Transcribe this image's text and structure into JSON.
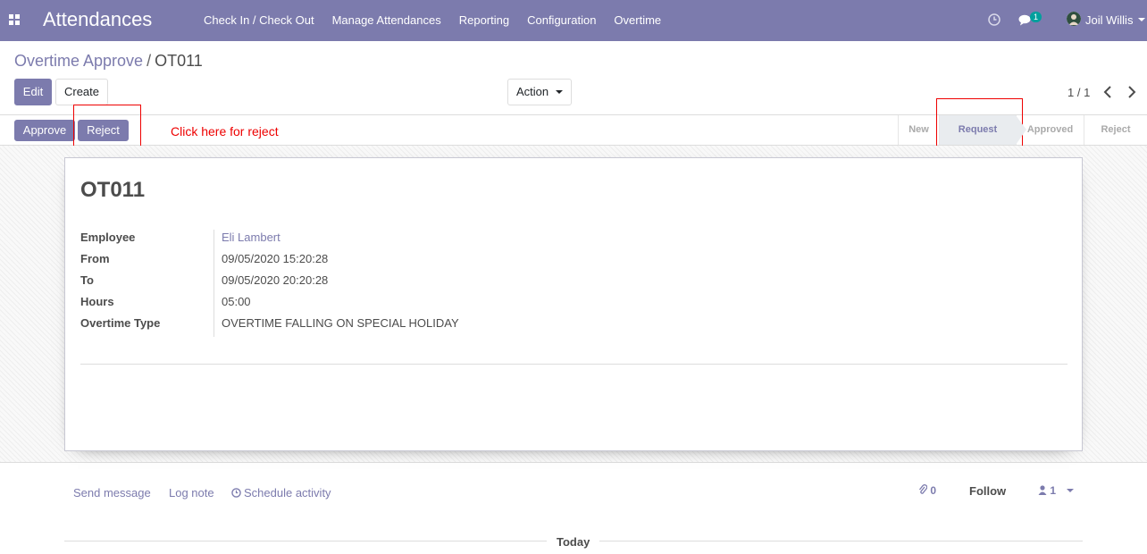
{
  "navbar": {
    "app_title": "Attendances",
    "menu": [
      "Check In / Check Out",
      "Manage Attendances",
      "Reporting",
      "Configuration",
      "Overtime"
    ],
    "chat_badge": "1",
    "user_name": "Joil Willis"
  },
  "breadcrumb": {
    "parent": "Overtime Approve",
    "separator": "/",
    "current": "OT011"
  },
  "controls": {
    "edit_label": "Edit",
    "create_label": "Create",
    "action_label": "Action",
    "pager": "1 / 1"
  },
  "statusbar": {
    "approve_label": "Approve",
    "reject_label": "Reject",
    "stages": [
      "New",
      "Request",
      "Approved",
      "Reject"
    ],
    "active_stage": "Request"
  },
  "annotation": {
    "text": "Click here for reject",
    "color": "#e00000"
  },
  "record": {
    "title": "OT011",
    "fields": [
      {
        "label": "Employee",
        "value": "Eli Lambert"
      },
      {
        "label": "From",
        "value": "09/05/2020 15:20:28"
      },
      {
        "label": "To",
        "value": "09/05/2020 20:20:28"
      },
      {
        "label": "Hours",
        "value": "05:00"
      },
      {
        "label": "Overtime Type",
        "value": "OVERTIME FALLING ON SPECIAL HOLIDAY"
      }
    ]
  },
  "chatter": {
    "send_message": "Send message",
    "log_note": "Log note",
    "schedule_activity": "Schedule activity",
    "attachments_count": "0",
    "follow_label": "Follow",
    "followers_count": "1",
    "today_label": "Today"
  },
  "colors": {
    "brand": "#7c7bad",
    "badge": "#00a09d"
  }
}
